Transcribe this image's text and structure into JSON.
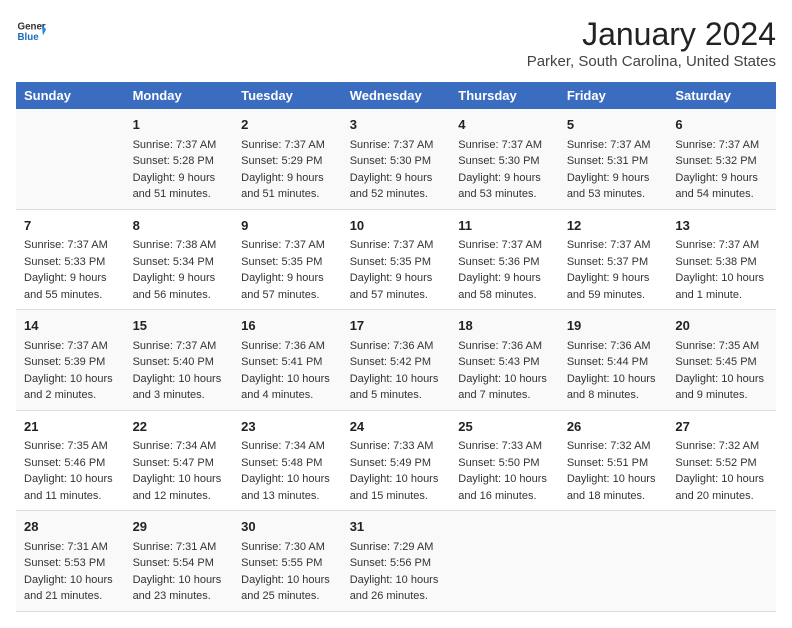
{
  "logo": {
    "general": "General",
    "blue": "Blue"
  },
  "header": {
    "title": "January 2024",
    "subtitle": "Parker, South Carolina, United States"
  },
  "days_of_week": [
    "Sunday",
    "Monday",
    "Tuesday",
    "Wednesday",
    "Thursday",
    "Friday",
    "Saturday"
  ],
  "weeks": [
    [
      {
        "day": "",
        "content": ""
      },
      {
        "day": "1",
        "content": "Sunrise: 7:37 AM\nSunset: 5:28 PM\nDaylight: 9 hours\nand 51 minutes."
      },
      {
        "day": "2",
        "content": "Sunrise: 7:37 AM\nSunset: 5:29 PM\nDaylight: 9 hours\nand 51 minutes."
      },
      {
        "day": "3",
        "content": "Sunrise: 7:37 AM\nSunset: 5:30 PM\nDaylight: 9 hours\nand 52 minutes."
      },
      {
        "day": "4",
        "content": "Sunrise: 7:37 AM\nSunset: 5:30 PM\nDaylight: 9 hours\nand 53 minutes."
      },
      {
        "day": "5",
        "content": "Sunrise: 7:37 AM\nSunset: 5:31 PM\nDaylight: 9 hours\nand 53 minutes."
      },
      {
        "day": "6",
        "content": "Sunrise: 7:37 AM\nSunset: 5:32 PM\nDaylight: 9 hours\nand 54 minutes."
      }
    ],
    [
      {
        "day": "7",
        "content": "Sunrise: 7:37 AM\nSunset: 5:33 PM\nDaylight: 9 hours\nand 55 minutes."
      },
      {
        "day": "8",
        "content": "Sunrise: 7:38 AM\nSunset: 5:34 PM\nDaylight: 9 hours\nand 56 minutes."
      },
      {
        "day": "9",
        "content": "Sunrise: 7:37 AM\nSunset: 5:35 PM\nDaylight: 9 hours\nand 57 minutes."
      },
      {
        "day": "10",
        "content": "Sunrise: 7:37 AM\nSunset: 5:35 PM\nDaylight: 9 hours\nand 57 minutes."
      },
      {
        "day": "11",
        "content": "Sunrise: 7:37 AM\nSunset: 5:36 PM\nDaylight: 9 hours\nand 58 minutes."
      },
      {
        "day": "12",
        "content": "Sunrise: 7:37 AM\nSunset: 5:37 PM\nDaylight: 9 hours\nand 59 minutes."
      },
      {
        "day": "13",
        "content": "Sunrise: 7:37 AM\nSunset: 5:38 PM\nDaylight: 10 hours\nand 1 minute."
      }
    ],
    [
      {
        "day": "14",
        "content": "Sunrise: 7:37 AM\nSunset: 5:39 PM\nDaylight: 10 hours\nand 2 minutes."
      },
      {
        "day": "15",
        "content": "Sunrise: 7:37 AM\nSunset: 5:40 PM\nDaylight: 10 hours\nand 3 minutes."
      },
      {
        "day": "16",
        "content": "Sunrise: 7:36 AM\nSunset: 5:41 PM\nDaylight: 10 hours\nand 4 minutes."
      },
      {
        "day": "17",
        "content": "Sunrise: 7:36 AM\nSunset: 5:42 PM\nDaylight: 10 hours\nand 5 minutes."
      },
      {
        "day": "18",
        "content": "Sunrise: 7:36 AM\nSunset: 5:43 PM\nDaylight: 10 hours\nand 7 minutes."
      },
      {
        "day": "19",
        "content": "Sunrise: 7:36 AM\nSunset: 5:44 PM\nDaylight: 10 hours\nand 8 minutes."
      },
      {
        "day": "20",
        "content": "Sunrise: 7:35 AM\nSunset: 5:45 PM\nDaylight: 10 hours\nand 9 minutes."
      }
    ],
    [
      {
        "day": "21",
        "content": "Sunrise: 7:35 AM\nSunset: 5:46 PM\nDaylight: 10 hours\nand 11 minutes."
      },
      {
        "day": "22",
        "content": "Sunrise: 7:34 AM\nSunset: 5:47 PM\nDaylight: 10 hours\nand 12 minutes."
      },
      {
        "day": "23",
        "content": "Sunrise: 7:34 AM\nSunset: 5:48 PM\nDaylight: 10 hours\nand 13 minutes."
      },
      {
        "day": "24",
        "content": "Sunrise: 7:33 AM\nSunset: 5:49 PM\nDaylight: 10 hours\nand 15 minutes."
      },
      {
        "day": "25",
        "content": "Sunrise: 7:33 AM\nSunset: 5:50 PM\nDaylight: 10 hours\nand 16 minutes."
      },
      {
        "day": "26",
        "content": "Sunrise: 7:32 AM\nSunset: 5:51 PM\nDaylight: 10 hours\nand 18 minutes."
      },
      {
        "day": "27",
        "content": "Sunrise: 7:32 AM\nSunset: 5:52 PM\nDaylight: 10 hours\nand 20 minutes."
      }
    ],
    [
      {
        "day": "28",
        "content": "Sunrise: 7:31 AM\nSunset: 5:53 PM\nDaylight: 10 hours\nand 21 minutes."
      },
      {
        "day": "29",
        "content": "Sunrise: 7:31 AM\nSunset: 5:54 PM\nDaylight: 10 hours\nand 23 minutes."
      },
      {
        "day": "30",
        "content": "Sunrise: 7:30 AM\nSunset: 5:55 PM\nDaylight: 10 hours\nand 25 minutes."
      },
      {
        "day": "31",
        "content": "Sunrise: 7:29 AM\nSunset: 5:56 PM\nDaylight: 10 hours\nand 26 minutes."
      },
      {
        "day": "",
        "content": ""
      },
      {
        "day": "",
        "content": ""
      },
      {
        "day": "",
        "content": ""
      }
    ]
  ]
}
